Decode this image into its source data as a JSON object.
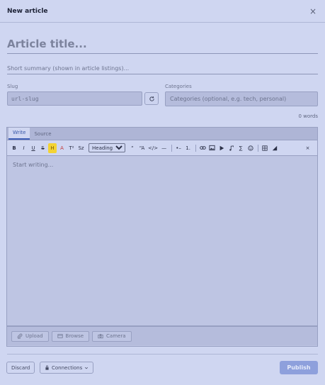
{
  "dialog": {
    "title": "New article",
    "close_symbol": "×"
  },
  "form": {
    "title_placeholder": "Article title...",
    "summary_placeholder": "Short summary (shown in article listings)...",
    "slug_label": "Slug",
    "slug_placeholder": "url-slug",
    "categories_label": "Categories",
    "categories_placeholder": "Categories (optional, e.g. tech, personal)",
    "word_count": "0 words"
  },
  "editor": {
    "tabs": [
      {
        "label": "Write",
        "active": true
      },
      {
        "label": "Source",
        "active": false
      }
    ],
    "toolbar": {
      "bold": "B",
      "italic": "I",
      "underline": "U",
      "strike": "S",
      "highlight": "H",
      "text_color": "A",
      "superscript": "T²",
      "subscript": "Sz",
      "heading_select": "Heading...",
      "quote": "“",
      "font_size": "“A",
      "code": "</>",
      "hr": "—",
      "bullet_list": "•–",
      "numbered_list": "1.",
      "math": "∑",
      "close": "×"
    },
    "placeholder": "Start writing..."
  },
  "upload": {
    "upload_label": "Upload",
    "browse_label": "Browse",
    "camera_label": "Camera"
  },
  "footer": {
    "discard_label": "Discard",
    "connections_label": "Connections",
    "publish_label": "Publish"
  },
  "colors": {
    "background": "#cfd6f1",
    "accent": "#3d5db6",
    "publish": "#8ea0dc",
    "highlight": "#f3d334"
  }
}
